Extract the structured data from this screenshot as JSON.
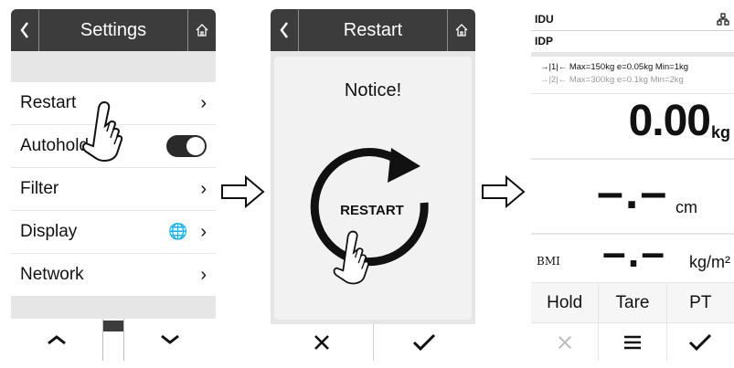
{
  "screen1": {
    "title": "Settings",
    "items": [
      {
        "label": "Restart"
      },
      {
        "label": "Autohold"
      },
      {
        "label": "Filter"
      },
      {
        "label": "Display"
      },
      {
        "label": "Network"
      }
    ]
  },
  "screen2": {
    "title": "Restart",
    "notice": "Notice!",
    "button_label": "RESTART"
  },
  "screen3": {
    "idu": "IDU",
    "idp": "IDP",
    "range1": "→|1|← Max=150kg e=0.05kg Min=1kg",
    "range2": "→|2|← Max=300kg e=0.1kg Min=2kg",
    "weight_value": "0.00",
    "weight_unit": "kg",
    "height_value": "–.–",
    "height_unit": "cm",
    "bmi_label": "BMI",
    "bmi_value": "–.–",
    "bmi_unit": "kg/m²",
    "softkeys": [
      "Hold",
      "Tare",
      "PT"
    ]
  },
  "icons": {
    "back": "chevron-left-icon",
    "home": "home-icon",
    "network": "network-icon",
    "touch": "pointing-hand-icon"
  }
}
